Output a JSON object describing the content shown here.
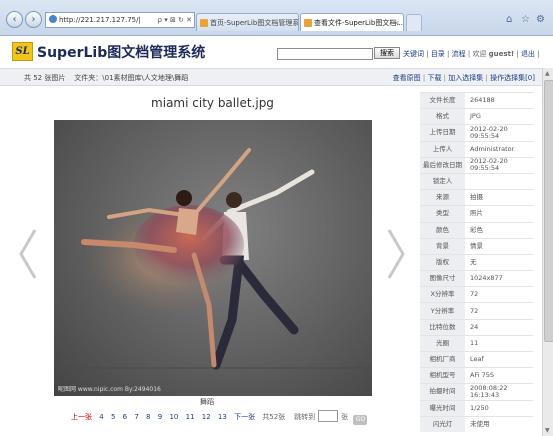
{
  "browser": {
    "address": "http://221.217.127.75/|",
    "address_tools": "ρ ▾ ⊠ ↻ ✕",
    "tabs": [
      {
        "label": "首页-SuperLib图文档管理系统"
      },
      {
        "label": "查看文件-SuperLib图文档..."
      }
    ],
    "back_icon": "‹",
    "forward_icon": "›",
    "tab_close": "×",
    "window_controls": [
      "⌂",
      "☆",
      "⚙"
    ]
  },
  "header": {
    "logo_mark": "SL",
    "logo_text": "SuperLib图文档管理系统",
    "search_button": "搜索",
    "nav": [
      "关键词",
      "目录",
      "流程"
    ],
    "welcome": "欢迎",
    "user": "guest!",
    "logout": "退出",
    "sep": " | "
  },
  "infobar": {
    "count": "共 52 张图片",
    "folder_label": "文件夹：",
    "folder_path": "\\01素材图库\\人文地理\\舞蹈",
    "actions": [
      "查看原图",
      "下载",
      "加入选择集",
      "操作选择集[0]"
    ]
  },
  "viewer": {
    "title": "miami city ballet.jpg",
    "caption": "舞蹈",
    "watermark": "昵图网 www.nipic.com  By:2494016"
  },
  "pager": {
    "prev": "上一张",
    "pages": [
      "4",
      "5",
      "6",
      "7",
      "8",
      "9",
      "10",
      "11",
      "12",
      "13"
    ],
    "next": "下一张",
    "total": "共52张",
    "jump_label": "跳转到",
    "unit": "张",
    "go": "GO"
  },
  "metadata": [
    {
      "key": "文件长度",
      "value": "264188"
    },
    {
      "key": "格式",
      "value": "JPG"
    },
    {
      "key": "上传日期",
      "value": "2012-02-20 09:55:54"
    },
    {
      "key": "上传人",
      "value": "Administrator"
    },
    {
      "key": "最后修改日期",
      "value": "2012-02-20 09:55:54"
    },
    {
      "key": "锁定人",
      "value": ""
    },
    {
      "key": "来源",
      "value": "拍摄"
    },
    {
      "key": "类型",
      "value": "照片"
    },
    {
      "key": "颜色",
      "value": "彩色"
    },
    {
      "key": "背景",
      "value": "情景"
    },
    {
      "key": "版权",
      "value": "无"
    },
    {
      "key": "图像尺寸",
      "value": "1024x877"
    },
    {
      "key": "X分辨率",
      "value": "72"
    },
    {
      "key": "Y分辨率",
      "value": "72"
    },
    {
      "key": "比特位数",
      "value": "24"
    },
    {
      "key": "光圈",
      "value": "11"
    },
    {
      "key": "相机厂商",
      "value": "Leaf"
    },
    {
      "key": "相机型号",
      "value": "AFi 75S"
    },
    {
      "key": "拍摄时间",
      "value": "2008:08:22 16:13:43"
    },
    {
      "key": "曝光时间",
      "value": "1/250"
    },
    {
      "key": "闪光灯",
      "value": "未使用"
    }
  ]
}
